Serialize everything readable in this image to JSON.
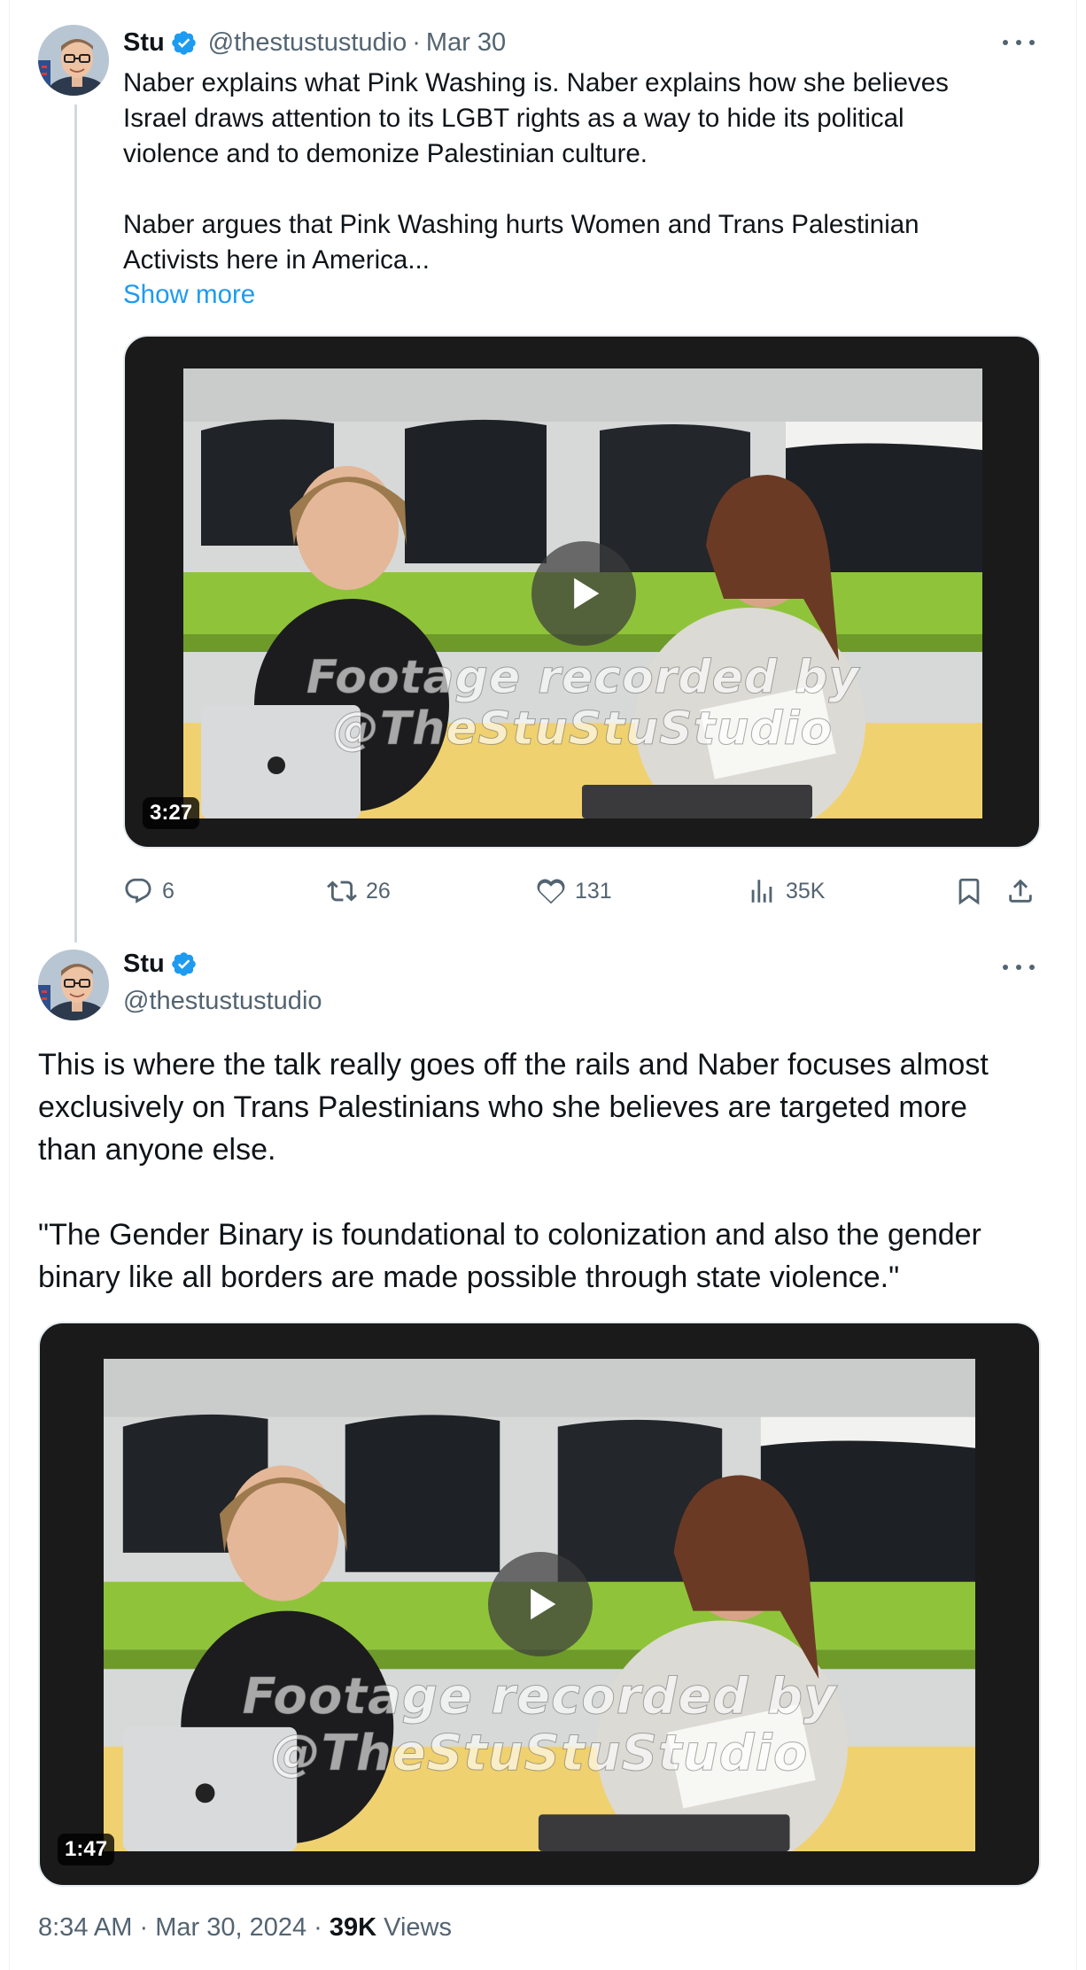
{
  "post1": {
    "author_name": "Stu",
    "handle": "@thestustustudio",
    "separator": "·",
    "date": "Mar 30",
    "text_lines": [
      "Naber explains what Pink Washing is. Naber explains how she believes",
      "Israel draws attention to its LGBT rights as a way to hide its political",
      "violence and to demonize Palestinian culture.",
      "",
      "Naber argues that Pink Washing hurts Women and Trans Palestinian",
      "Activists here in America..."
    ],
    "show_more": "Show more",
    "video": {
      "duration": "3:27",
      "watermark_line1": "Footage recorded by",
      "watermark_line2": "@TheStuStuStudio"
    },
    "actions": {
      "replies": "6",
      "reposts": "26",
      "likes": "131",
      "views": "35K"
    }
  },
  "post2": {
    "author_name": "Stu",
    "handle": "@thestustustudio",
    "text_lines": [
      "This is where the talk really goes off the rails and Naber focuses almost",
      "exclusively on Trans Palestinians who she believes are targeted more",
      "than anyone else.",
      "",
      "\"The Gender Binary is foundational to colonization and also the gender",
      "binary like all borders are made possible through state violence.\""
    ],
    "video": {
      "duration": "1:47",
      "watermark_line1": "Footage recorded by",
      "watermark_line2": "@TheStuStuStudio"
    },
    "meta": {
      "time": "8:34 AM",
      "separator": "·",
      "date": "Mar 30, 2024",
      "views_count": "39K",
      "views_label": "Views"
    }
  },
  "colors": {
    "accent": "#1d9bf0",
    "text": "#0f1419",
    "muted": "#536471",
    "verified": "#1d9bf0"
  },
  "icons": [
    "more-icon",
    "verified-badge-icon",
    "reply-icon",
    "repost-icon",
    "like-icon",
    "views-icon",
    "bookmark-icon",
    "share-icon",
    "play-icon"
  ]
}
